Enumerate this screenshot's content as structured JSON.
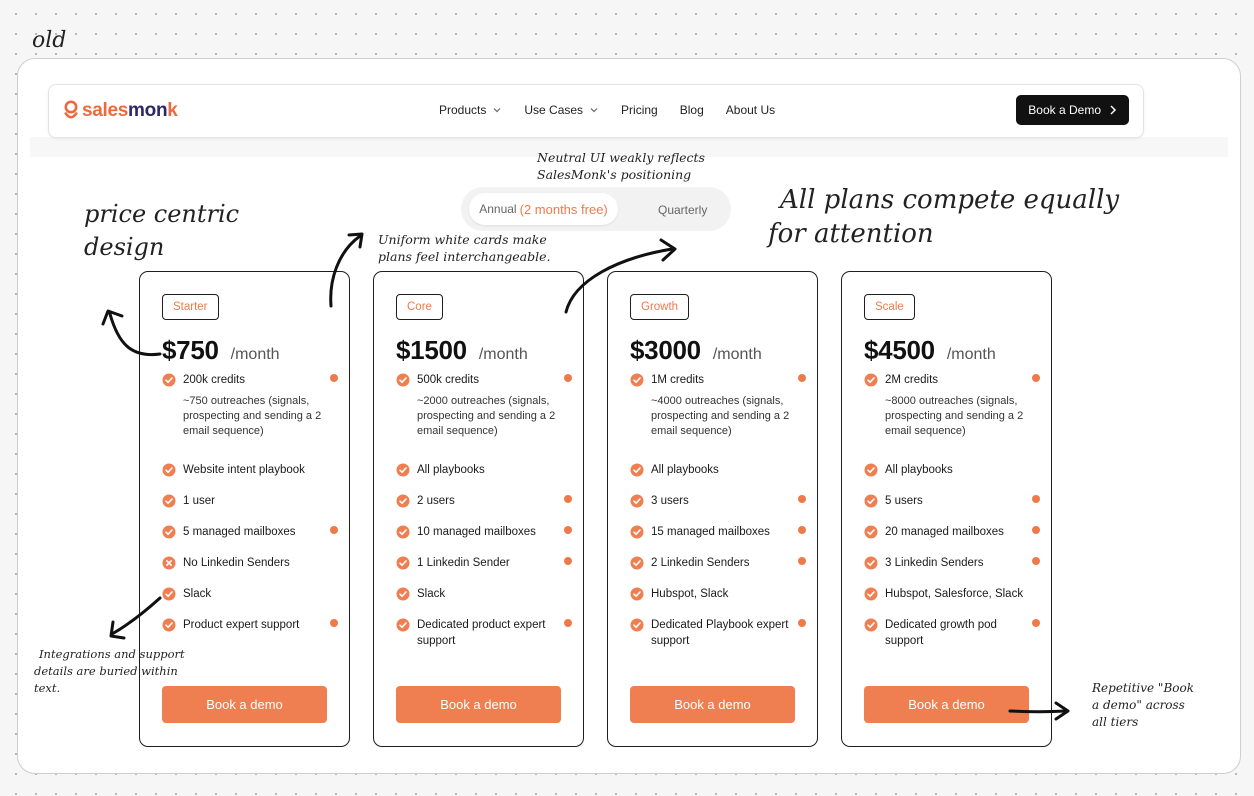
{
  "annotations": {
    "old_label": "old",
    "price_centric": [
      "price centric",
      "design"
    ],
    "uniform_cards": [
      "Uniform white cards make",
      "plans feel interchangeable."
    ],
    "neutral_ui": [
      "Neutral UI weakly reflects",
      "SalesMonk's positioning"
    ],
    "compete": [
      "All plans compete equally",
      "for attention"
    ],
    "integrations": [
      "Integrations and support",
      "details are buried within",
      "text."
    ],
    "repetitive": [
      "Repetitive \"Book",
      "a demo\" across",
      "all tiers"
    ]
  },
  "navbar": {
    "logo_part1": "sales",
    "logo_part2": "mon",
    "logo_part3": "k",
    "links": [
      {
        "label": "Products",
        "dropdown": true
      },
      {
        "label": "Use Cases",
        "dropdown": true
      },
      {
        "label": "Pricing",
        "dropdown": false
      },
      {
        "label": "Blog",
        "dropdown": false
      },
      {
        "label": "About Us",
        "dropdown": false
      }
    ],
    "cta_label": "Book a Demo"
  },
  "billing_toggle": {
    "annual_label": "Annual",
    "annual_free": "(2 months free)",
    "quarterly_label": "Quarterly",
    "selected": "annual"
  },
  "plans": [
    {
      "name": "Starter",
      "price": "$750",
      "period": "/month",
      "features": [
        {
          "label": "200k credits",
          "note": "~750 outreaches (signals, prospecting and sending a 2 email sequence)",
          "info": true,
          "included": true
        },
        {
          "label": "Website intent playbook",
          "info": false,
          "included": true
        },
        {
          "label": "1 user",
          "info": false,
          "included": true
        },
        {
          "label": "5 managed mailboxes",
          "info": true,
          "included": true
        },
        {
          "label": "No Linkedin Senders",
          "info": false,
          "included": false
        },
        {
          "label": "Slack",
          "info": false,
          "included": true
        },
        {
          "label": "Product expert support",
          "info": true,
          "included": true
        }
      ],
      "cta": "Book a demo"
    },
    {
      "name": "Core",
      "price": "$1500",
      "period": "/month",
      "features": [
        {
          "label": "500k credits",
          "note": "~2000 outreaches (signals, prospecting and sending a 2 email sequence)",
          "info": true,
          "included": true
        },
        {
          "label": "All playbooks",
          "info": false,
          "included": true
        },
        {
          "label": "2 users",
          "info": true,
          "included": true
        },
        {
          "label": "10 managed mailboxes",
          "info": true,
          "included": true
        },
        {
          "label": "1 Linkedin Sender",
          "info": true,
          "included": true
        },
        {
          "label": "Slack",
          "info": false,
          "included": true
        },
        {
          "label": "Dedicated product expert support",
          "info": true,
          "included": true
        }
      ],
      "cta": "Book a demo"
    },
    {
      "name": "Growth",
      "price": "$3000",
      "period": "/month",
      "features": [
        {
          "label": "1M credits",
          "note": "~4000 outreaches (signals, prospecting and sending a 2 email sequence)",
          "info": true,
          "included": true
        },
        {
          "label": "All playbooks",
          "info": false,
          "included": true
        },
        {
          "label": "3 users",
          "info": true,
          "included": true
        },
        {
          "label": "15 managed mailboxes",
          "info": true,
          "included": true
        },
        {
          "label": "2 Linkedin Senders",
          "info": true,
          "included": true
        },
        {
          "label": "Hubspot, Slack",
          "info": false,
          "included": true
        },
        {
          "label": "Dedicated Playbook expert support",
          "info": true,
          "included": true
        }
      ],
      "cta": "Book a demo"
    },
    {
      "name": "Scale",
      "price": "$4500",
      "period": "/month",
      "features": [
        {
          "label": "2M credits",
          "note": "~8000 outreaches (signals, prospecting and sending a 2 email sequence)",
          "info": true,
          "included": true
        },
        {
          "label": "All playbooks",
          "info": false,
          "included": true
        },
        {
          "label": "5 users",
          "info": true,
          "included": true
        },
        {
          "label": "20 managed mailboxes",
          "info": true,
          "included": true
        },
        {
          "label": "3 Linkedin Senders",
          "info": true,
          "included": true
        },
        {
          "label": "Hubspot, Salesforce, Slack",
          "info": false,
          "included": true
        },
        {
          "label": "Dedicated growth pod support",
          "info": true,
          "included": true
        }
      ],
      "cta": "Book a demo"
    }
  ],
  "colors": {
    "accent": "#ef7f50",
    "brand_navy": "#2c2868",
    "nav_cta_bg": "#111111"
  }
}
